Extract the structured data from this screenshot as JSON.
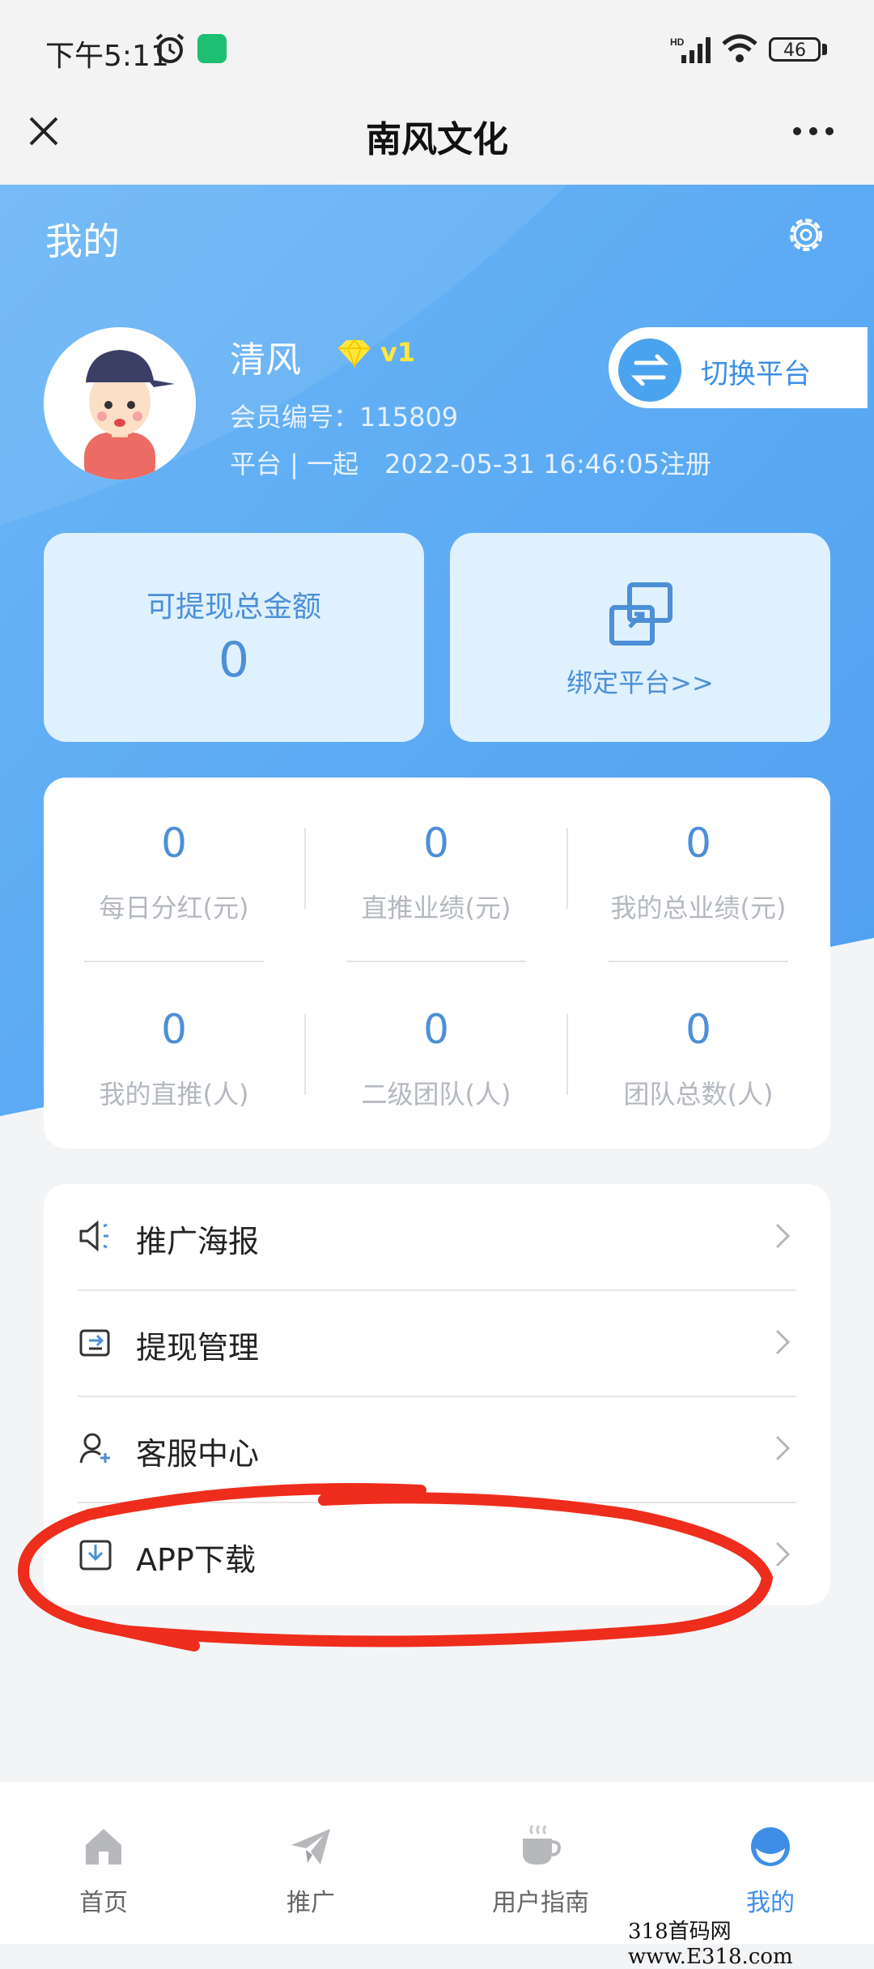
{
  "status_bar": {
    "time": "下午5:11",
    "battery": "46"
  },
  "header": {
    "title": "南风文化"
  },
  "profile": {
    "section_title": "我的",
    "username": "清风",
    "level": "v1",
    "member_id_line": "会员编号：115809",
    "platform_line": "平台 | 一起　2022-05-31 16:46:05注册",
    "switch_platform": "切换平台"
  },
  "cards": {
    "withdraw_label": "可提现总金额",
    "withdraw_value": "0",
    "bind_label": "绑定平台>>"
  },
  "stats": [
    {
      "value": "0",
      "label": "每日分红(元)"
    },
    {
      "value": "0",
      "label": "直推业绩(元)"
    },
    {
      "value": "0",
      "label": "我的总业绩(元)"
    },
    {
      "value": "0",
      "label": "我的直推(人)"
    },
    {
      "value": "0",
      "label": "二级团队(人)"
    },
    {
      "value": "0",
      "label": "团队总数(人)"
    }
  ],
  "menu": [
    {
      "label": "推广海报",
      "icon": "megaphone-icon"
    },
    {
      "label": "提现管理",
      "icon": "wallet-icon"
    },
    {
      "label": "客服中心",
      "icon": "user-support-icon"
    },
    {
      "label": "APP下载",
      "icon": "download-icon"
    }
  ],
  "tabs": [
    {
      "label": "首页",
      "icon": "home-icon"
    },
    {
      "label": "推广",
      "icon": "paper-plane-icon"
    },
    {
      "label": "用户指南",
      "icon": "coffee-cup-icon"
    },
    {
      "label": "我的",
      "icon": "profile-icon",
      "active": true
    }
  ],
  "watermark": "318首码网 www.E318.com",
  "colors": {
    "accent": "#4c8fd6",
    "header_blue": "#5aaaf5",
    "card_bg": "#dff0ff",
    "annotation_red": "#ee2d1c"
  }
}
